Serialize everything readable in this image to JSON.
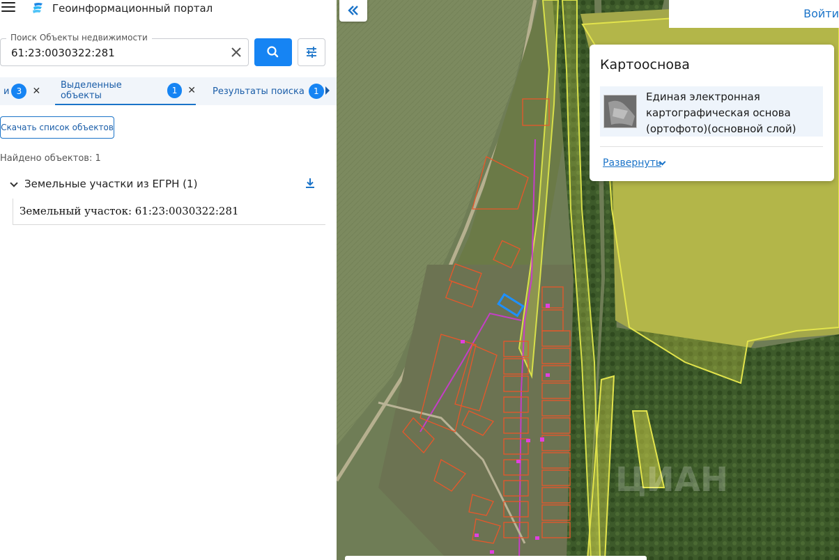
{
  "header": {
    "app_title": "Геоинформационный портал"
  },
  "search": {
    "legend": "Поиск Объекты недвижимости",
    "value": "61:23:0030322:281"
  },
  "tabs": [
    {
      "label": "и",
      "count": "3"
    },
    {
      "label": "Выделенные объекты",
      "count": "1"
    },
    {
      "label": "Результаты поиска",
      "count": "1"
    }
  ],
  "results": {
    "download_list_label": "Скачать список объектов",
    "found_text": "Найдено объектов: 1",
    "group_label": "Земельные участки из ЕГРН (1)",
    "item_label": "Земельный участок: 61:23:0030322:281"
  },
  "map": {
    "login_label": "Войти",
    "basemap": {
      "title": "Картооснова",
      "layer_label": "Единая электронная картографическая основа (ортофото)(основной слой)",
      "expand_label": "Развернуть"
    },
    "watermark": "ЦИАН"
  },
  "colors": {
    "accent": "#1684f3",
    "parcel_outline": "#e8572a",
    "selected_parcel": "#1e90ff",
    "zone_outline": "#d8e04a"
  }
}
